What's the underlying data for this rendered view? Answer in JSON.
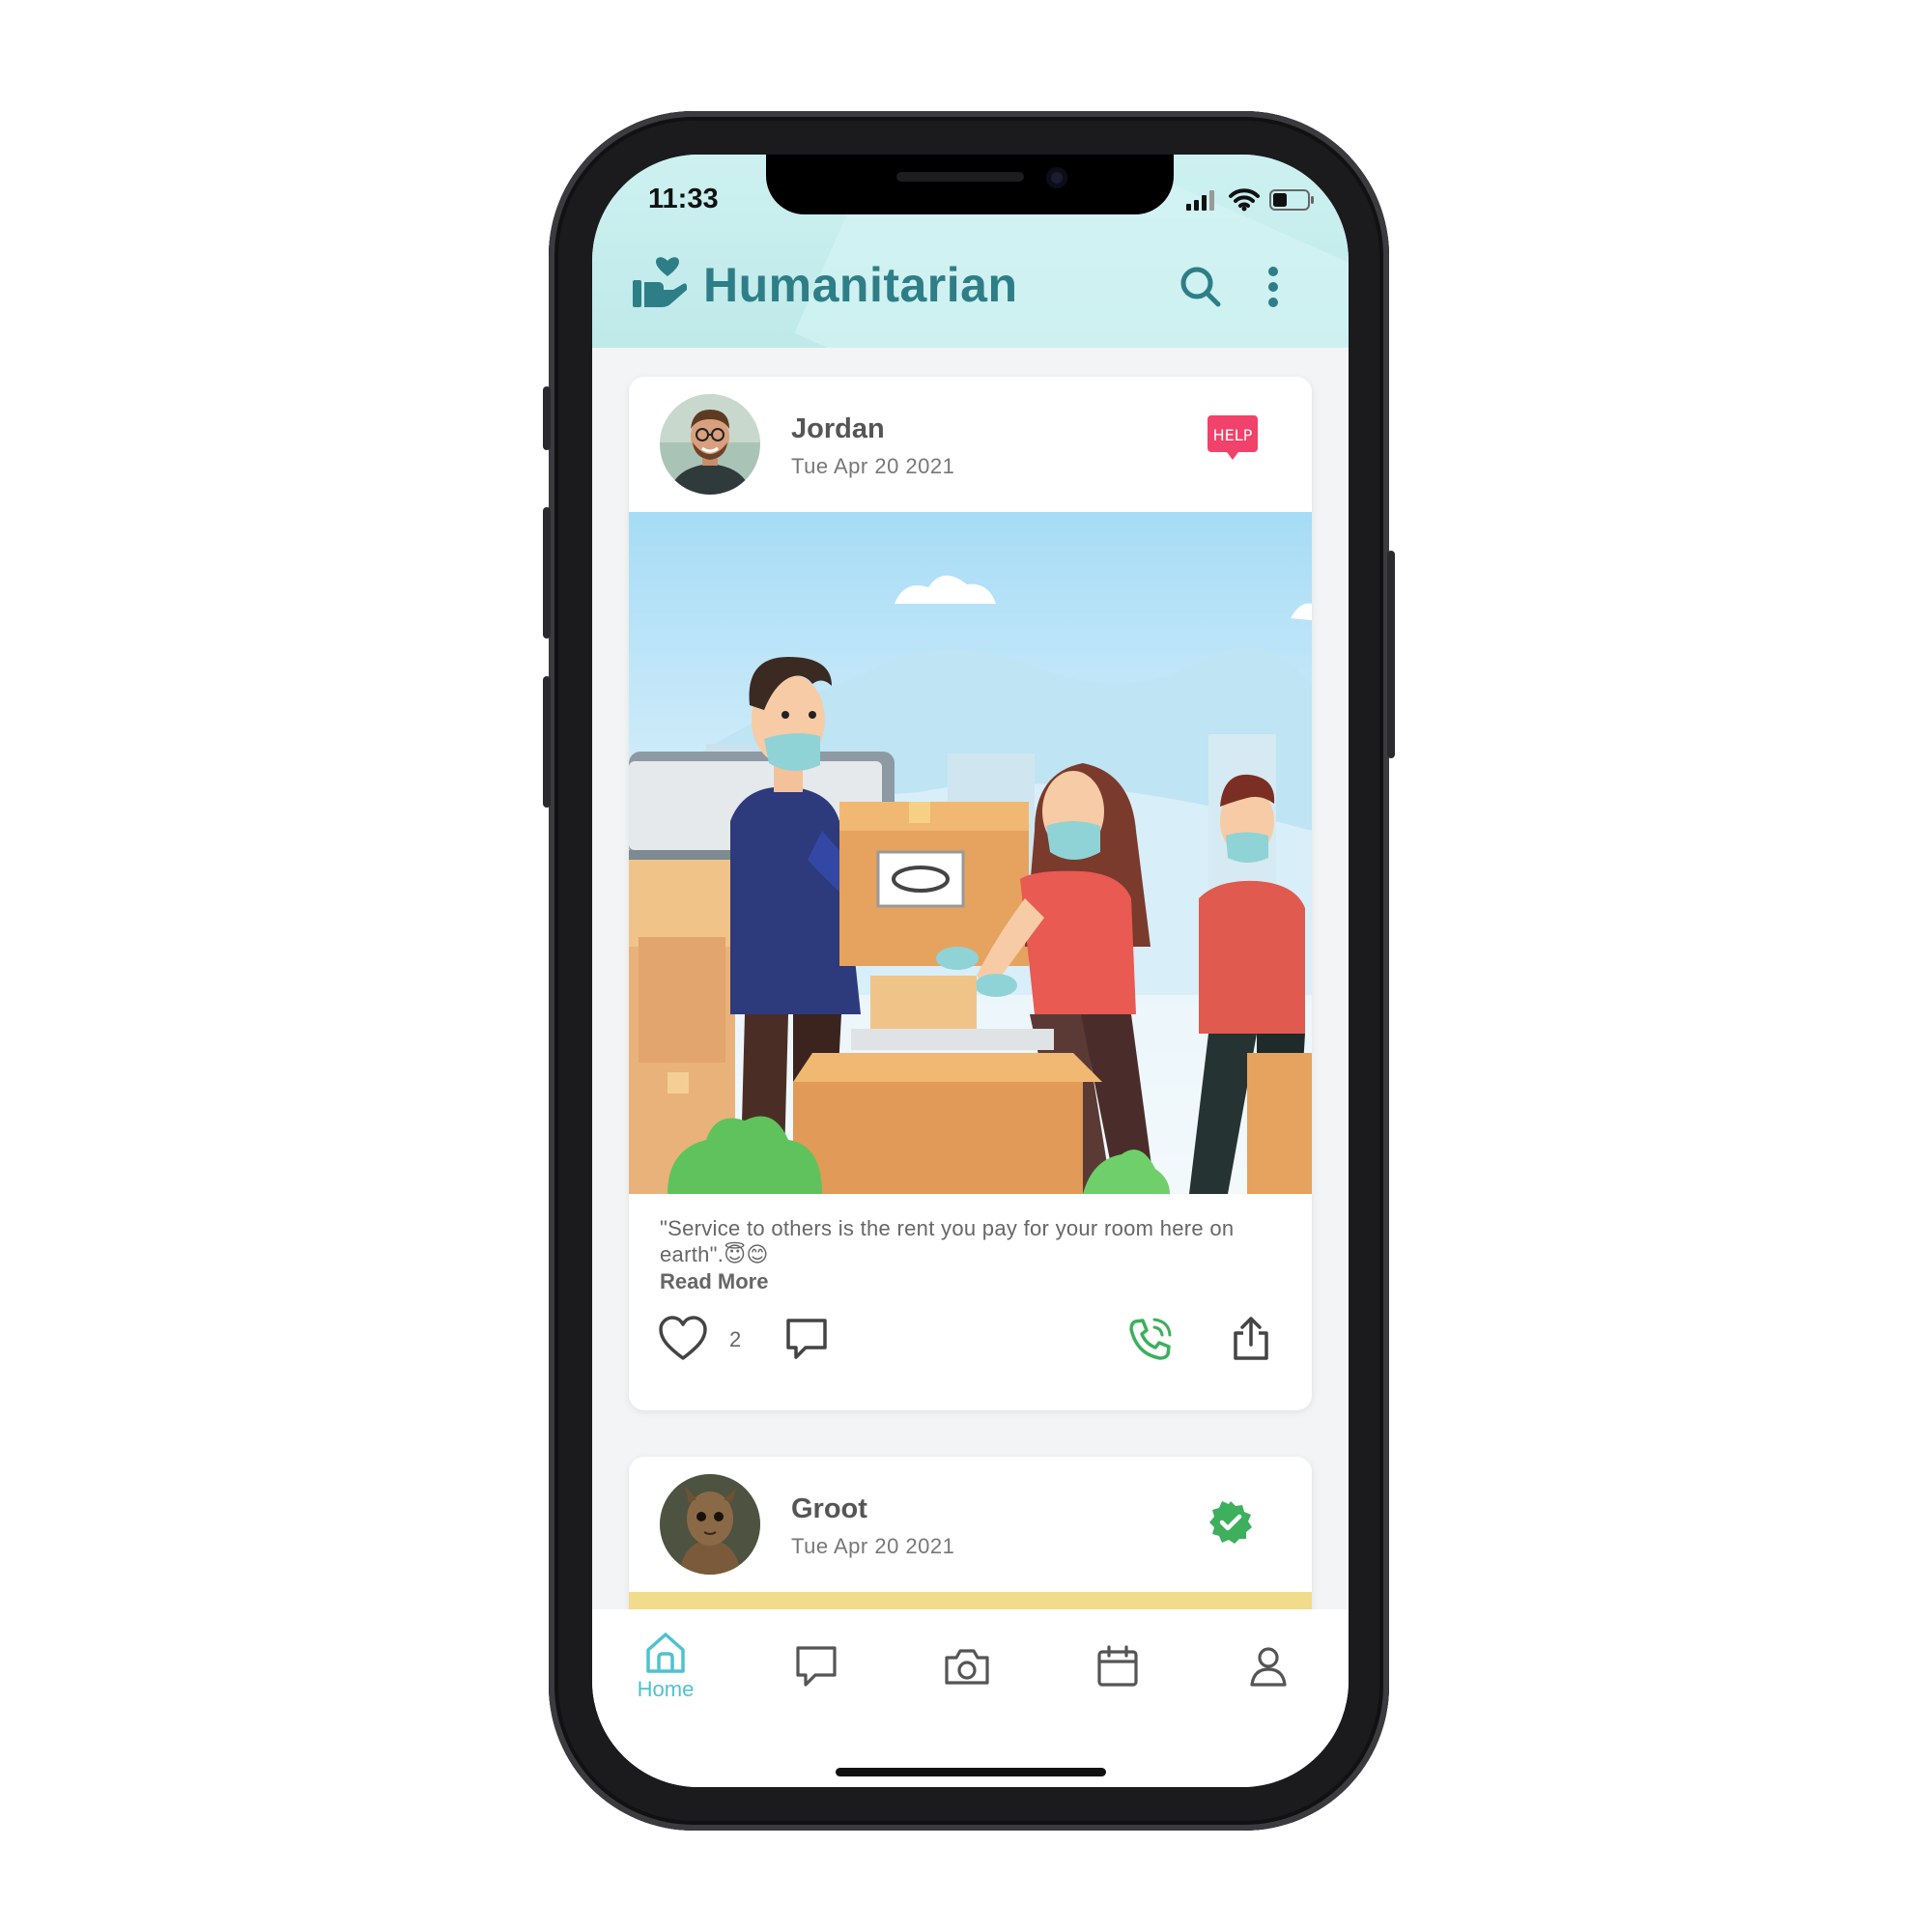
{
  "status_bar": {
    "time": "11:33"
  },
  "header": {
    "title": "Humanitarian",
    "search_icon": "search-icon",
    "menu_icon": "more-vertical-icon"
  },
  "posts": [
    {
      "author": "Jordan",
      "date": "Tue Apr 20 2021",
      "badge": "HELP",
      "text": "\"Service to others is the rent you pay for your room here on earth\".😇😊",
      "read_more": "Read More",
      "likes": "2"
    },
    {
      "author": "Groot",
      "date": "Tue Apr 20 2021",
      "badge_icon": "verified-icon"
    }
  ],
  "tabbar": {
    "items": [
      {
        "label": "Home",
        "icon": "home-icon",
        "active": true
      },
      {
        "label": "",
        "icon": "chat-icon"
      },
      {
        "label": "",
        "icon": "camera-icon"
      },
      {
        "label": "",
        "icon": "calendar-icon"
      },
      {
        "label": "",
        "icon": "profile-icon"
      }
    ]
  },
  "colors": {
    "brand": "#2e7e87",
    "header_bg": "#c8eff0",
    "accent_tab": "#4ec2d0",
    "help_badge": "#f0426a",
    "verified": "#3daf5d",
    "call": "#3daf5d"
  }
}
